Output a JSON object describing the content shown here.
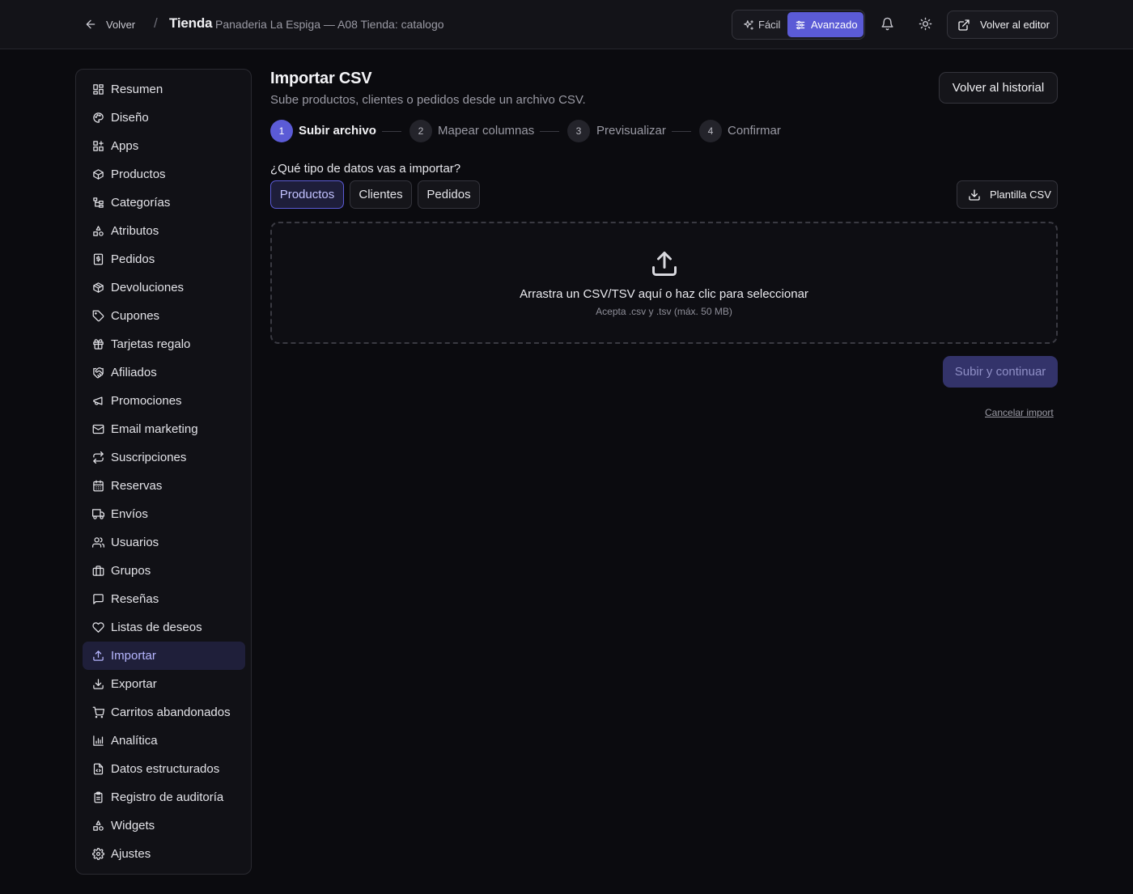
{
  "header": {
    "back_label": "Volver",
    "separator": "/",
    "title": "Tienda",
    "subtitle": "Panaderia La Espiga — A08 Tienda: catalogo",
    "mode_easy": "Fácil",
    "mode_advanced": "Avanzado",
    "editor_button": "Volver al editor"
  },
  "sidebar": {
    "items": [
      {
        "label": "Resumen",
        "icon": "dashboard-icon"
      },
      {
        "label": "Diseño",
        "icon": "palette-icon"
      },
      {
        "label": "Apps",
        "icon": "apps-icon"
      },
      {
        "label": "Productos",
        "icon": "box-icon"
      },
      {
        "label": "Categorías",
        "icon": "tree-icon"
      },
      {
        "label": "Atributos",
        "icon": "shapes-icon"
      },
      {
        "label": "Pedidos",
        "icon": "receipt-icon"
      },
      {
        "label": "Devoluciones",
        "icon": "package-return-icon"
      },
      {
        "label": "Cupones",
        "icon": "tag-icon"
      },
      {
        "label": "Tarjetas regalo",
        "icon": "gift-icon"
      },
      {
        "label": "Afiliados",
        "icon": "handshake-icon"
      },
      {
        "label": "Promociones",
        "icon": "megaphone-icon"
      },
      {
        "label": "Email marketing",
        "icon": "mail-icon"
      },
      {
        "label": "Suscripciones",
        "icon": "repeat-icon"
      },
      {
        "label": "Reservas",
        "icon": "calendar-icon"
      },
      {
        "label": "Envíos",
        "icon": "truck-icon"
      },
      {
        "label": "Usuarios",
        "icon": "users-icon"
      },
      {
        "label": "Grupos",
        "icon": "briefcase-icon"
      },
      {
        "label": "Reseñas",
        "icon": "message-icon"
      },
      {
        "label": "Listas de deseos",
        "icon": "heart-icon"
      },
      {
        "label": "Importar",
        "icon": "upload-icon"
      },
      {
        "label": "Exportar",
        "icon": "download-icon"
      },
      {
        "label": "Carritos abandonados",
        "icon": "cart-icon"
      },
      {
        "label": "Analítica",
        "icon": "bar-chart-icon"
      },
      {
        "label": "Datos estructurados",
        "icon": "file-code-icon"
      },
      {
        "label": "Registro de auditoría",
        "icon": "clipboard-icon"
      },
      {
        "label": "Widgets",
        "icon": "shapes-icon"
      },
      {
        "label": "Ajustes",
        "icon": "gear-icon"
      }
    ],
    "active_index": 20
  },
  "main": {
    "title": "Importar CSV",
    "subtitle": "Sube productos, clientes o pedidos desde un archivo CSV.",
    "history_button": "Volver al historial",
    "steps": [
      {
        "number": "1",
        "label": "Subir archivo"
      },
      {
        "number": "2",
        "label": "Mapear columnas"
      },
      {
        "number": "3",
        "label": "Previsualizar"
      },
      {
        "number": "4",
        "label": "Confirmar"
      }
    ],
    "active_step": 0,
    "question": "¿Qué tipo de datos vas a importar?",
    "types": [
      "Productos",
      "Clientes",
      "Pedidos"
    ],
    "active_type": 0,
    "template_button": "Plantilla CSV",
    "dropzone_title": "Arrastra un CSV/TSV aquí o haz clic para seleccionar",
    "dropzone_subtitle": "Acepta .csv y .tsv (máx. 50 MB)",
    "upload_button": "Subir y continuar",
    "cancel_link": "Cancelar import"
  },
  "colors": {
    "accent": "#5b5bd6",
    "background": "#0b0b0f",
    "panel": "#111116"
  }
}
